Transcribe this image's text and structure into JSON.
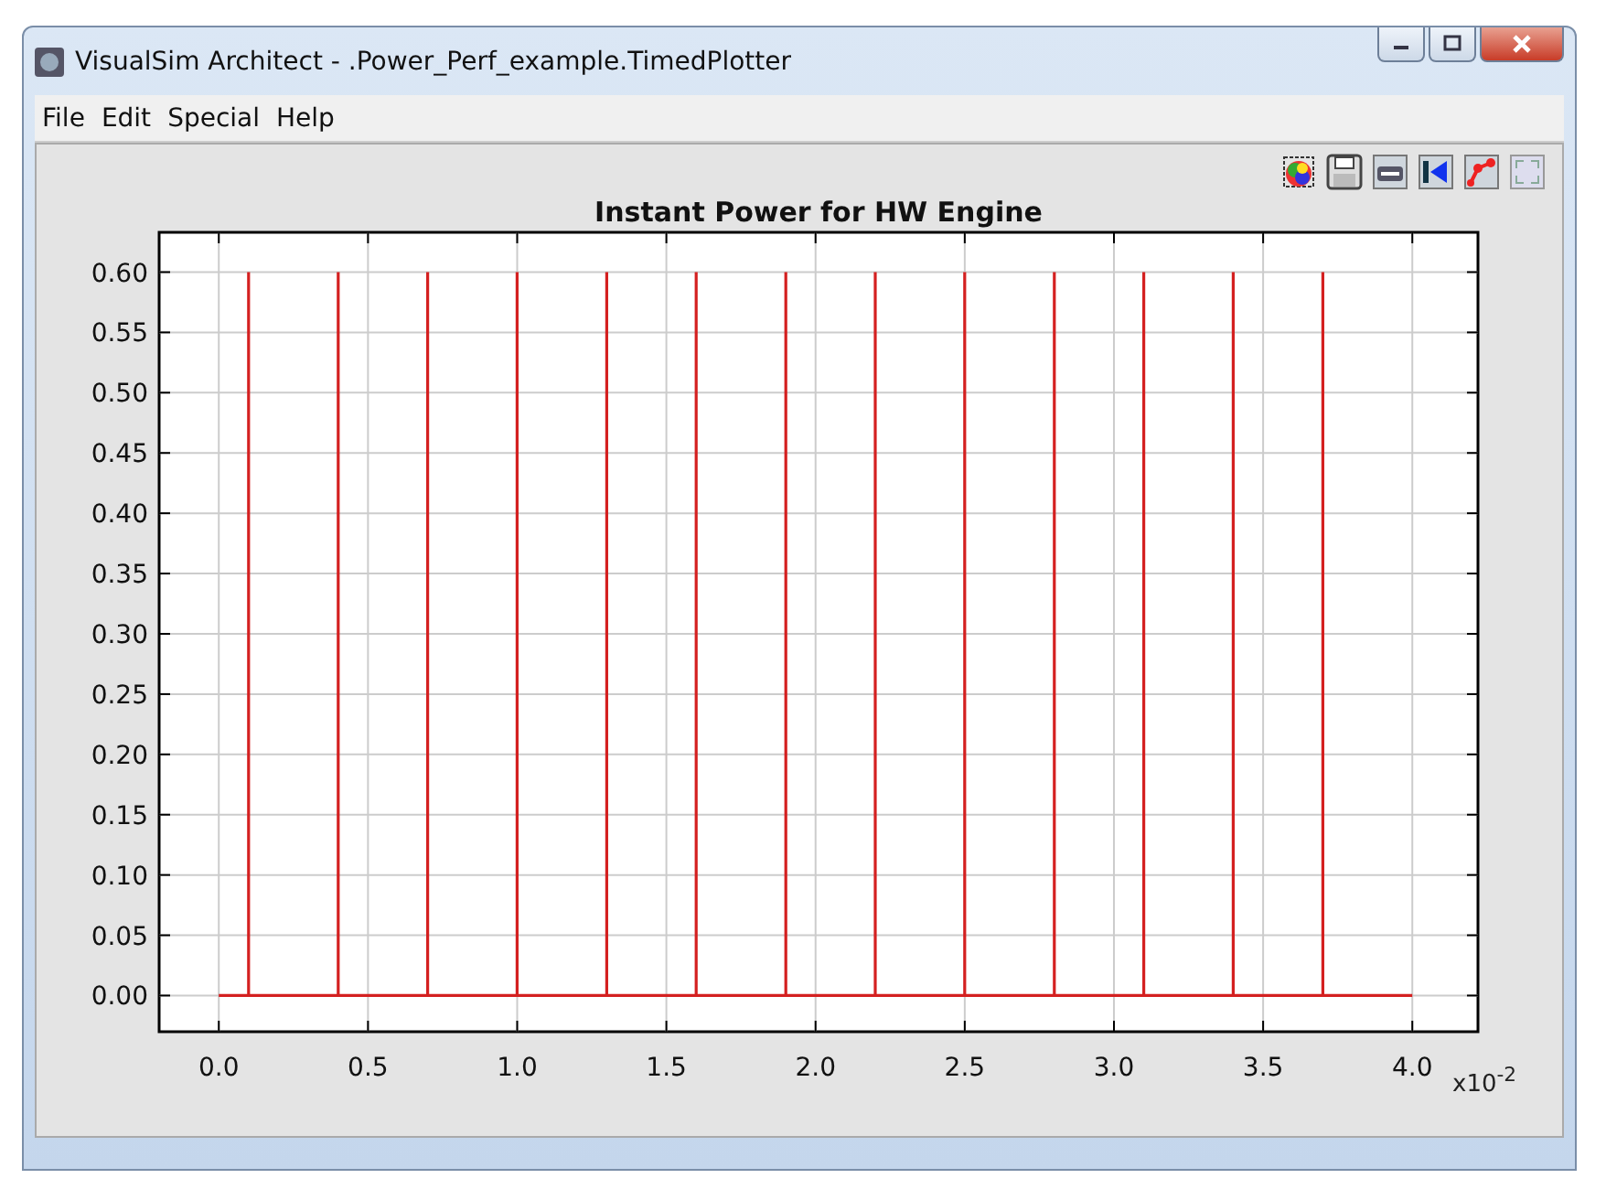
{
  "window": {
    "title": "VisualSim Architect - .Power_Perf_example.TimedPlotter"
  },
  "menu": [
    "File",
    "Edit",
    "Special",
    "Help"
  ],
  "toolbar": [
    {
      "kind": "palette"
    },
    {
      "kind": "save"
    },
    {
      "kind": "print"
    },
    {
      "kind": "reset"
    },
    {
      "kind": "points"
    },
    {
      "kind": "fit"
    }
  ],
  "plot": {
    "x_multiplier": "x10$^{-2}$",
    "chart_data": {
      "type": "line",
      "title": "Instant Power for HW Engine",
      "x": [
        0,
        0.1,
        0.1,
        0.1,
        0.4,
        0.4,
        0.4,
        0.7,
        0.7,
        0.7,
        1.0,
        1.0,
        1.0,
        1.3,
        1.3,
        1.3,
        1.6,
        1.6,
        1.6,
        1.9,
        1.9,
        1.9,
        2.2,
        2.2,
        2.2,
        2.5,
        2.5,
        2.5,
        2.8,
        2.8,
        2.8,
        3.1,
        3.1,
        3.1,
        3.4,
        3.4,
        3.4,
        3.7,
        3.7,
        3.7,
        4.0
      ],
      "grid": true,
      "series": [
        {
          "color": "#d42020",
          "values": [
            0,
            0,
            0.6,
            0,
            0,
            0.6,
            0,
            0,
            0.6,
            0,
            0,
            0.6,
            0,
            0,
            0.6,
            0,
            0,
            0.6,
            0,
            0,
            0.6,
            0,
            0,
            0.6,
            0,
            0,
            0.6,
            0,
            0,
            0.6,
            0,
            0,
            0.6,
            0,
            0,
            0.6,
            0,
            0,
            0.6,
            0,
            0
          ]
        }
      ],
      "xlim": [
        -0.2,
        4.22
      ],
      "ylim": [
        -0.03,
        0.633
      ],
      "xticks": [
        {
          "value": 0,
          "label": "0.0"
        },
        {
          "value": 0.5,
          "label": "0.5"
        },
        {
          "value": 1,
          "label": "1.0"
        },
        {
          "value": 1.5,
          "label": "1.5"
        },
        {
          "value": 2,
          "label": "2.0"
        },
        {
          "value": 2.5,
          "label": "2.5"
        },
        {
          "value": 3,
          "label": "3.0"
        },
        {
          "value": 3.5,
          "label": "3.5"
        },
        {
          "value": 4,
          "label": "4.0"
        }
      ],
      "yticks": [
        {
          "value": 0,
          "label": "0.00"
        },
        {
          "value": 0.05,
          "label": "0.05"
        },
        {
          "value": 0.1,
          "label": "0.10"
        },
        {
          "value": 0.15,
          "label": "0.15"
        },
        {
          "value": 0.2,
          "label": "0.20"
        },
        {
          "value": 0.25,
          "label": "0.25"
        },
        {
          "value": 0.3,
          "label": "0.30"
        },
        {
          "value": 0.35,
          "label": "0.35"
        },
        {
          "value": 0.4,
          "label": "0.40"
        },
        {
          "value": 0.45,
          "label": "0.45"
        },
        {
          "value": 0.5,
          "label": "0.50"
        },
        {
          "value": 0.55,
          "label": "0.55"
        },
        {
          "value": 0.6,
          "label": "0.60"
        }
      ]
    }
  }
}
